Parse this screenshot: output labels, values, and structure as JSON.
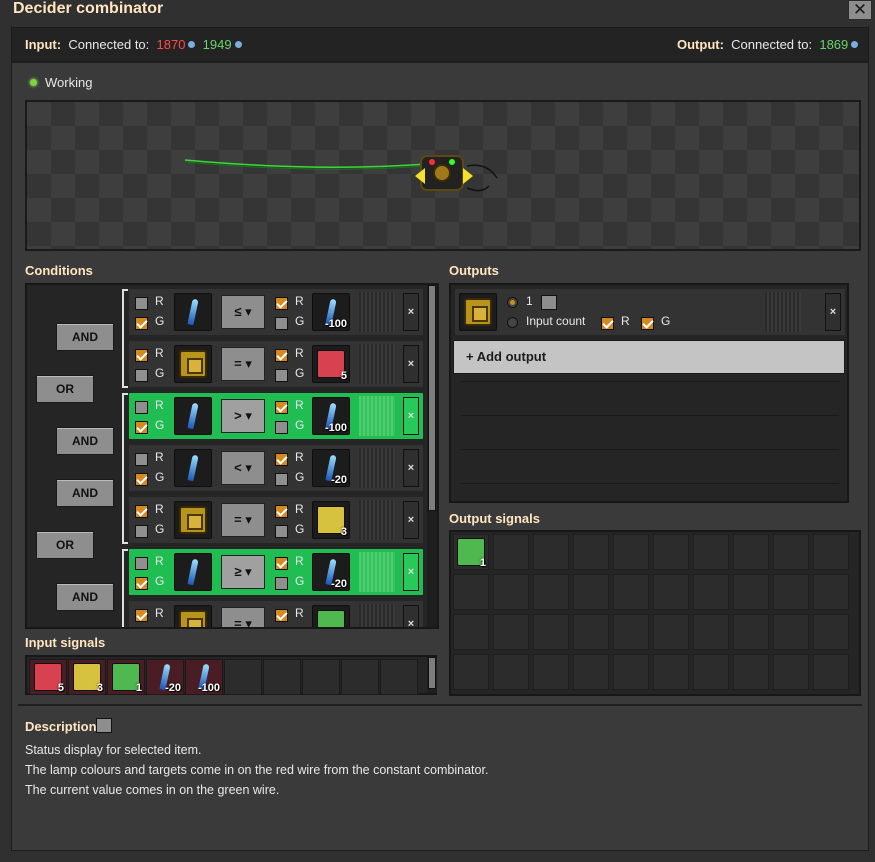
{
  "window": {
    "title": "Decider combinator",
    "close_icon": "close-icon"
  },
  "connections": {
    "input_label": "Input:",
    "input_connected": "Connected to:",
    "input_red": "1870",
    "input_green": "1949",
    "output_label": "Output:",
    "output_connected": "Connected to:",
    "output_green": "1869"
  },
  "status": {
    "text": "Working",
    "color": "#7ed53d"
  },
  "sections": {
    "conditions": "Conditions",
    "outputs": "Outputs",
    "input_signals": "Input signals",
    "output_signals": "Output signals",
    "description": "Description"
  },
  "wires": {
    "r": "R",
    "g": "G"
  },
  "logic": {
    "and": "AND",
    "or": "OR",
    "remove": "×"
  },
  "conditions": [
    {
      "left_r": false,
      "left_g": true,
      "left_icon": "pen-icon",
      "op": "≤",
      "right_r": true,
      "right_g": false,
      "right_icon": "pen-icon",
      "right_value": "-100",
      "active": false
    },
    {
      "left_r": true,
      "left_g": false,
      "left_icon": "chip-icon",
      "op": "=",
      "right_r": true,
      "right_g": false,
      "right_icon": "red-square",
      "right_value": "5",
      "active": false
    },
    {
      "left_r": false,
      "left_g": true,
      "left_icon": "pen-icon",
      "op": ">",
      "right_r": true,
      "right_g": false,
      "right_icon": "pen-icon",
      "right_value": "-100",
      "active": true
    },
    {
      "left_r": false,
      "left_g": true,
      "left_icon": "pen-icon",
      "op": "<",
      "right_r": true,
      "right_g": false,
      "right_icon": "pen-icon",
      "right_value": "-20",
      "active": false
    },
    {
      "left_r": true,
      "left_g": false,
      "left_icon": "chip-icon",
      "op": "=",
      "right_r": true,
      "right_g": false,
      "right_icon": "yellow-square",
      "right_value": "3",
      "active": false
    },
    {
      "left_r": false,
      "left_g": true,
      "left_icon": "pen-icon",
      "op": "≥",
      "right_r": true,
      "right_g": false,
      "right_icon": "pen-icon",
      "right_value": "-20",
      "active": true
    },
    {
      "left_r": true,
      "left_g": false,
      "left_icon": "chip-icon",
      "op": "=",
      "right_r": true,
      "right_g": false,
      "right_icon": "green-square",
      "right_value": "",
      "active": false
    }
  ],
  "output": {
    "value": "1",
    "input_count": "Input count",
    "add_output": "+ Add output"
  },
  "input_signals": [
    {
      "icon": "red-square",
      "value": "5",
      "color": "#d8414f"
    },
    {
      "icon": "yellow-square",
      "value": "3",
      "color": "#d6c23f"
    },
    {
      "icon": "green-square",
      "value": "1",
      "color": "#4fb84f"
    },
    {
      "icon": "pen-icon",
      "value": "-20"
    },
    {
      "icon": "pen-icon",
      "value": "-100"
    }
  ],
  "output_signals": [
    {
      "icon": "green-square",
      "value": "1",
      "color": "#4fb84f"
    }
  ],
  "description": {
    "line1": "Status display for selected item.",
    "line2": "The lamp colours and targets come in on the red wire from the constant combinator.",
    "line3": "The current value comes in on the green wire."
  },
  "colors": {
    "active_row": "#1fbd52",
    "checkbox_on": "#d48a1f",
    "red_text": "#ff4a45",
    "green_text": "#6ad36a"
  }
}
